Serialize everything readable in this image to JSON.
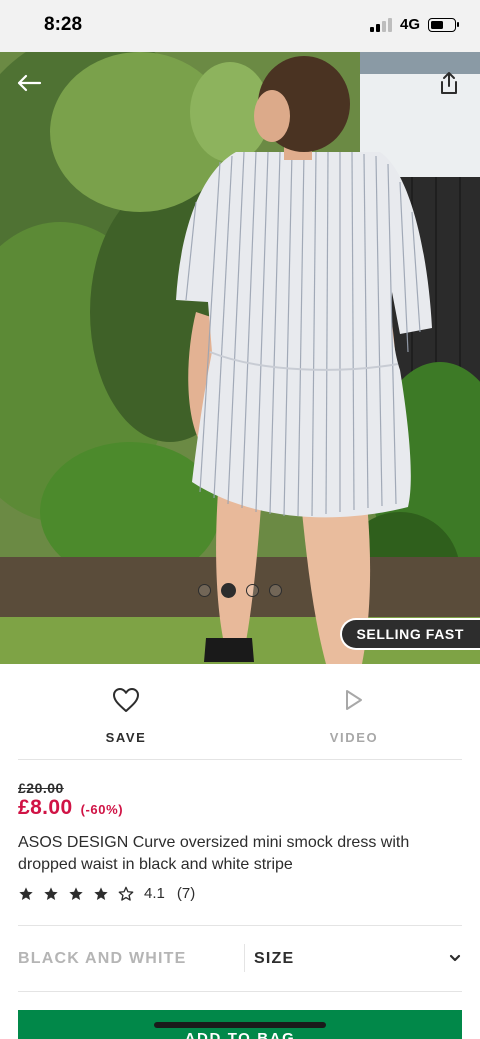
{
  "status_bar": {
    "time": "8:28",
    "network": "4G"
  },
  "hero": {
    "badge": "SELLING FAST",
    "dots": [
      {
        "active": false
      },
      {
        "active": true
      },
      {
        "active": false
      },
      {
        "active": false
      }
    ],
    "icons": {
      "back": "back-arrow-icon",
      "share": "share-icon"
    }
  },
  "actions": {
    "save_label": "SAVE",
    "video_label": "VIDEO"
  },
  "product": {
    "price_old": "£20.00",
    "price_new": "£8.00",
    "discount": "(-60%)",
    "title": "ASOS DESIGN Curve oversized mini smock dress with dropped waist in black and white stripe",
    "rating": {
      "stars_filled": 4,
      "stars_total": 5,
      "value": "4.1",
      "count": "(7)"
    }
  },
  "variant": {
    "colour": "BLACK AND WHITE",
    "size_label": "SIZE"
  },
  "cta": {
    "label": "ADD TO BAG"
  },
  "colors": {
    "price": "#d01345",
    "cta": "#018849",
    "text": "#2d2d2d",
    "muted": "#b5b5b5"
  }
}
